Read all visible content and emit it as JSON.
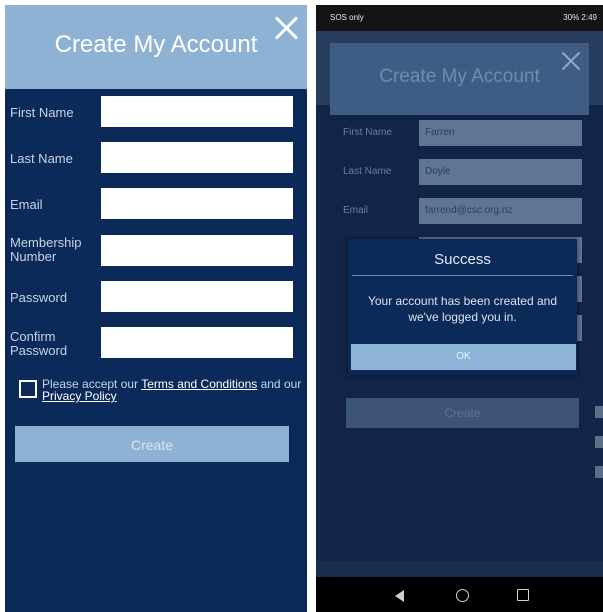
{
  "signup": {
    "title": "Create My Account",
    "fields": [
      {
        "label": "First Name",
        "value": ""
      },
      {
        "label": "Last Name",
        "value": ""
      },
      {
        "label": "Email",
        "value": ""
      },
      {
        "label": "Membership Number",
        "value": ""
      },
      {
        "label": "Password",
        "value": ""
      },
      {
        "label": "Confirm Password",
        "value": ""
      }
    ],
    "consent": {
      "prefix": "Please accept our ",
      "terms_link": "Terms and Conditions",
      "middle": " and our ",
      "privacy_link": "Privacy Policy"
    },
    "create_label": "Create"
  },
  "device": {
    "status_left": "SOS only",
    "status_right": "30% 2:49",
    "title": "Create My Account",
    "fields": [
      {
        "label": "First Name",
        "value": "Farren"
      },
      {
        "label": "Last Name",
        "value": "Doyle"
      },
      {
        "label": "Email",
        "value": "farrend@csc.org.nz"
      }
    ],
    "create_label": "Create"
  },
  "dialog": {
    "title": "Success",
    "message": "Your account has been created and we've logged you in.",
    "ok_label": "OK"
  },
  "colors": {
    "panel_bg": "#0b2a5a",
    "header_bg": "#8eb2d3",
    "button_bg": "#8eb2d3"
  }
}
